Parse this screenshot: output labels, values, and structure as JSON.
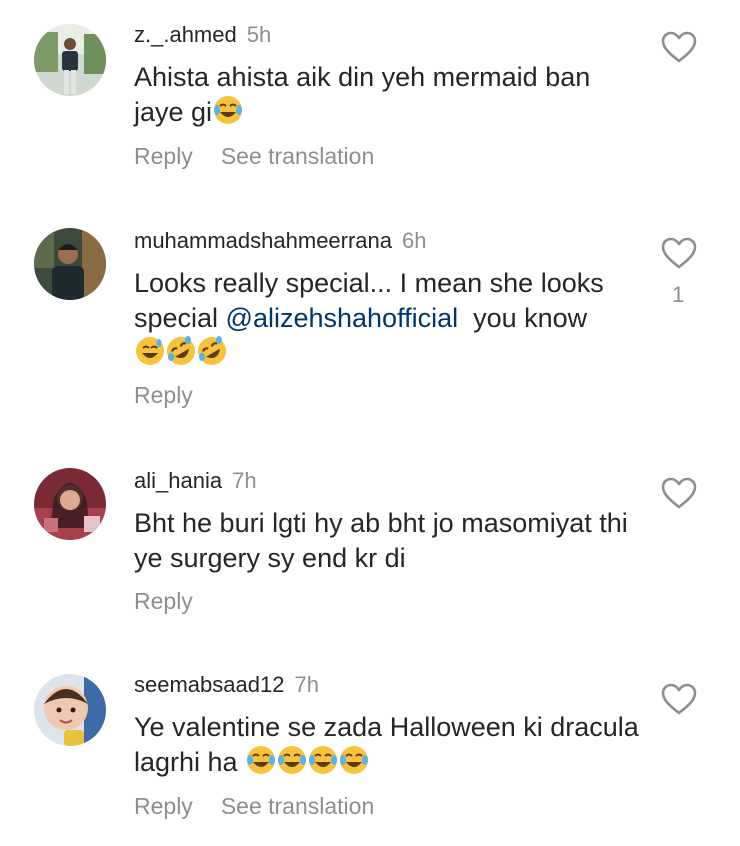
{
  "comments": [
    {
      "username": "z._.ahmed",
      "time": "5h",
      "text": "Ahista ahista aik din yeh mermaid ban jaye gi",
      "emojis": [
        "joy"
      ],
      "reply_label": "Reply",
      "translate_label": "See translation"
    },
    {
      "username": "muhammadshahmeerrana",
      "time": "6h",
      "text_before": "Looks really special... I mean she looks special ",
      "mention": "@alizehshahofficial",
      "text_after": "  you know",
      "emojis": [
        "grin-sweat",
        "rofl",
        "rofl"
      ],
      "like_count": "1",
      "reply_label": "Reply"
    },
    {
      "username": "ali_hania",
      "time": "7h",
      "text": "Bht he buri lgti hy ab bht jo masomiyat thi ye surgery sy end kr di",
      "reply_label": "Reply"
    },
    {
      "username": "seemabsaad12",
      "time": "7h",
      "text": "Ye valentine se zada Halloween ki dracula lagrhi ha",
      "emojis": [
        "joy",
        "joy",
        "joy",
        "joy"
      ],
      "reply_label": "Reply",
      "translate_label": "See translation"
    }
  ],
  "icons": {
    "like": "heart-outline-icon"
  },
  "colors": {
    "text": "#262626",
    "muted": "#8e8e8e",
    "mention": "#00376b",
    "emoji": "#f7c23c"
  }
}
